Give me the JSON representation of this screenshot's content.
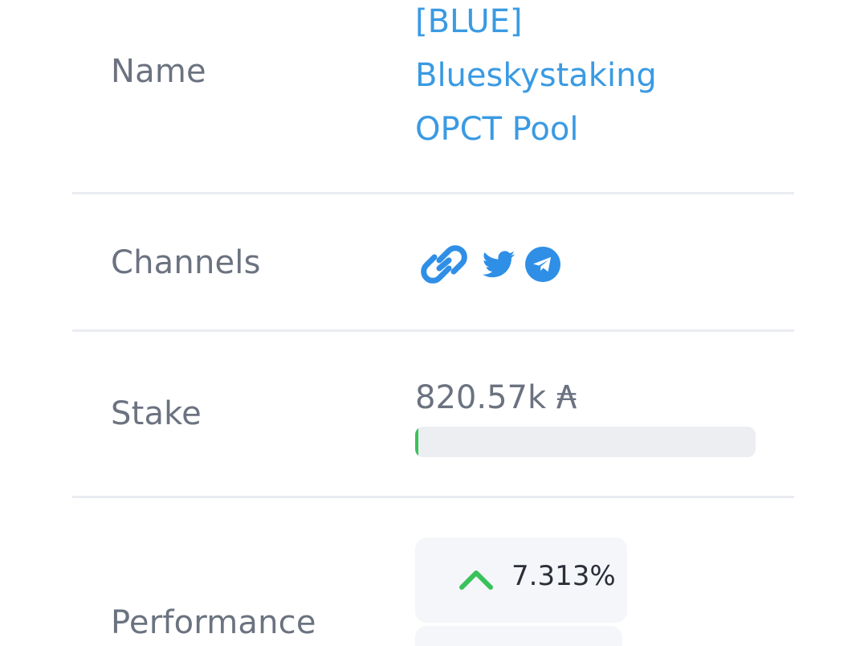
{
  "rows": {
    "name": {
      "label": "Name",
      "value_lines": [
        "[BLUE]",
        "Blueskystaking",
        "OPCT Pool"
      ]
    },
    "channels": {
      "label": "Channels",
      "icons": [
        "link-icon",
        "twitter-icon",
        "telegram-icon"
      ]
    },
    "stake": {
      "label": "Stake",
      "value": "820.57k ₳",
      "progress_fraction": 0.01
    },
    "performance": {
      "label": "Performance",
      "value": "7.313%",
      "trend": "up"
    }
  },
  "colors": {
    "link": "#3a9ae3",
    "label": "#6b7280",
    "progress_fill": "#38c25a",
    "trend_up": "#38c25a"
  }
}
